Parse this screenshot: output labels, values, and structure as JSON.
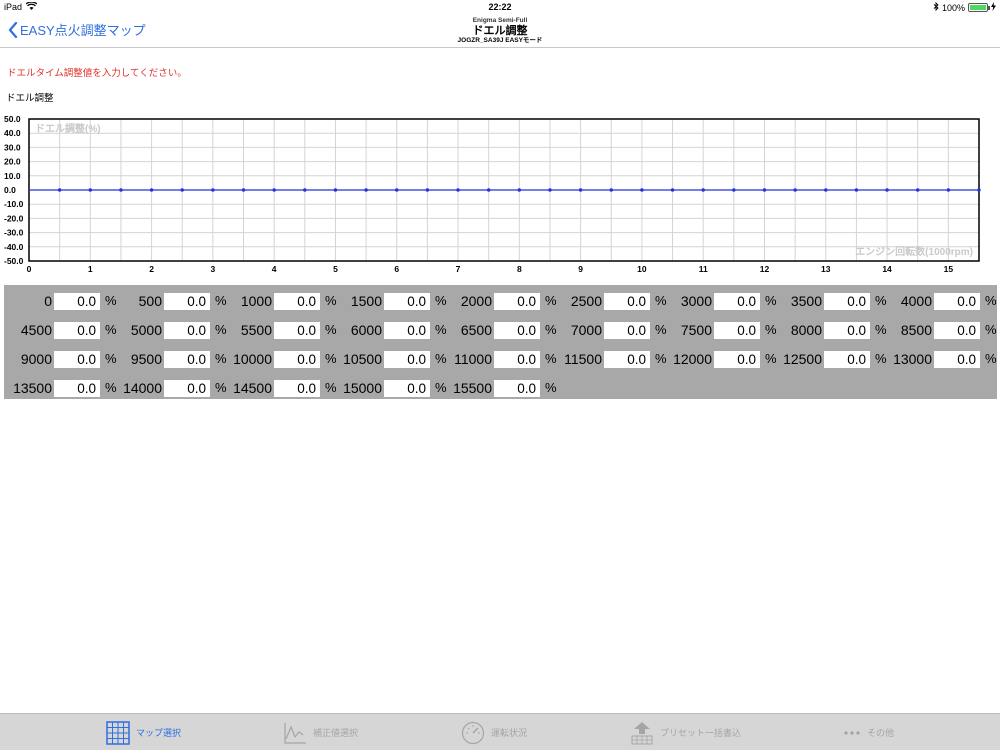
{
  "status_bar": {
    "device": "iPad",
    "time": "22:22",
    "battery_text": "100%",
    "battery_level": 1.0
  },
  "nav": {
    "back_label": "EASY点火調整マップ",
    "subtitle_top": "Enigma Semi-Full",
    "title": "ドエル調整",
    "subtitle_bottom": "JOGZR_SA39J EASYモード"
  },
  "instruction": "ドエルタイム調整値を入力してください。",
  "section_label": "ドエル調整",
  "colors": {
    "accent": "#2f6fe0",
    "instruction": "#e1302a",
    "line": "#2233dd",
    "table_bg": "#a8a8a8"
  },
  "chart_data": {
    "type": "line",
    "title": "ドエル調整(%)",
    "xlabel": "エンジン回転数(1000rpm)",
    "ylabel": "ドエル調整(%)",
    "xlim": [
      0,
      15.5
    ],
    "ylim": [
      -50,
      50
    ],
    "y_ticks": [
      "50.0",
      "40.0",
      "30.0",
      "20.0",
      "10.0",
      "0.0",
      "-10.0",
      "-20.0",
      "-30.0",
      "-40.0",
      "-50.0"
    ],
    "x_ticks": [
      "0",
      "1",
      "2",
      "3",
      "4",
      "5",
      "6",
      "7",
      "8",
      "9",
      "10",
      "11",
      "12",
      "13",
      "14",
      "15"
    ],
    "grid": true,
    "x": [
      0,
      0.5,
      1,
      1.5,
      2,
      2.5,
      3,
      3.5,
      4,
      4.5,
      5,
      5.5,
      6,
      6.5,
      7,
      7.5,
      8,
      8.5,
      9,
      9.5,
      10,
      10.5,
      11,
      11.5,
      12,
      12.5,
      13,
      13.5,
      14,
      14.5,
      15,
      15.5
    ],
    "y": [
      0,
      0,
      0,
      0,
      0,
      0,
      0,
      0,
      0,
      0,
      0,
      0,
      0,
      0,
      0,
      0,
      0,
      0,
      0,
      0,
      0,
      0,
      0,
      0,
      0,
      0,
      0,
      0,
      0,
      0,
      0,
      0
    ]
  },
  "table": {
    "unit": "%",
    "rows": [
      [
        {
          "rpm": "0",
          "value": "0.0"
        },
        {
          "rpm": "500",
          "value": "0.0"
        },
        {
          "rpm": "1000",
          "value": "0.0"
        },
        {
          "rpm": "1500",
          "value": "0.0"
        },
        {
          "rpm": "2000",
          "value": "0.0"
        },
        {
          "rpm": "2500",
          "value": "0.0"
        },
        {
          "rpm": "3000",
          "value": "0.0"
        },
        {
          "rpm": "3500",
          "value": "0.0"
        },
        {
          "rpm": "4000",
          "value": "0.0"
        }
      ],
      [
        {
          "rpm": "4500",
          "value": "0.0"
        },
        {
          "rpm": "5000",
          "value": "0.0"
        },
        {
          "rpm": "5500",
          "value": "0.0"
        },
        {
          "rpm": "6000",
          "value": "0.0"
        },
        {
          "rpm": "6500",
          "value": "0.0"
        },
        {
          "rpm": "7000",
          "value": "0.0"
        },
        {
          "rpm": "7500",
          "value": "0.0"
        },
        {
          "rpm": "8000",
          "value": "0.0"
        },
        {
          "rpm": "8500",
          "value": "0.0"
        }
      ],
      [
        {
          "rpm": "9000",
          "value": "0.0"
        },
        {
          "rpm": "9500",
          "value": "0.0"
        },
        {
          "rpm": "10000",
          "value": "0.0"
        },
        {
          "rpm": "10500",
          "value": "0.0"
        },
        {
          "rpm": "11000",
          "value": "0.0"
        },
        {
          "rpm": "11500",
          "value": "0.0"
        },
        {
          "rpm": "12000",
          "value": "0.0"
        },
        {
          "rpm": "12500",
          "value": "0.0"
        },
        {
          "rpm": "13000",
          "value": "0.0"
        }
      ],
      [
        {
          "rpm": "13500",
          "value": "0.0"
        },
        {
          "rpm": "14000",
          "value": "0.0"
        },
        {
          "rpm": "14500",
          "value": "0.0"
        },
        {
          "rpm": "15000",
          "value": "0.0"
        },
        {
          "rpm": "15500",
          "value": "0.0"
        }
      ]
    ]
  },
  "tabs": [
    {
      "label": "マップ選択",
      "icon": "grid-icon",
      "active": true
    },
    {
      "label": "補正値選択",
      "icon": "line-chart-icon",
      "active": false
    },
    {
      "label": "運転状況",
      "icon": "speedometer-icon",
      "active": false
    },
    {
      "label": "プリセット一括書込",
      "icon": "upload-icon",
      "active": false
    },
    {
      "label": "その他",
      "icon": "more-icon",
      "active": false
    }
  ]
}
